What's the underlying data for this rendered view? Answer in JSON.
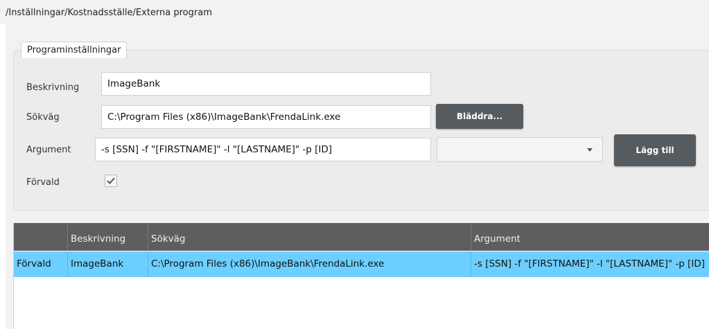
{
  "breadcrumb": "/Inställningar/Kostnadsställe/Externa program",
  "panel": {
    "legend": "Programinställningar",
    "fields": {
      "description_label": "Beskrivning",
      "description_value": "ImageBank",
      "path_label": "Sökväg",
      "path_value": "C:\\Program Files (x86)\\ImageBank\\FrendaLink.exe",
      "browse_button": "Bläddra...",
      "argument_label": "Argument",
      "argument_value": "-s [SSN] -f \"[FIRSTNAME]\" -l \"[LASTNAME]\" -p [ID]",
      "argument_select_value": "",
      "add_button": "Lägg till",
      "default_label": "Förvald",
      "default_checked": true
    }
  },
  "grid": {
    "columns": [
      "",
      "Beskrivning",
      "Sökväg",
      "Argument"
    ],
    "rows": [
      {
        "default": "Förvald",
        "description": "ImageBank",
        "path": "C:\\Program Files (x86)\\ImageBank\\FrendaLink.exe",
        "argument": "-s [SSN] -f \"[FIRSTNAME]\" -l \"[LASTNAME]\" -p [ID]",
        "selected": true
      }
    ]
  },
  "colors": {
    "header_bg": "#5e5e5e",
    "selected_row": "#6dcfff",
    "button_bg": "#555b5f"
  }
}
